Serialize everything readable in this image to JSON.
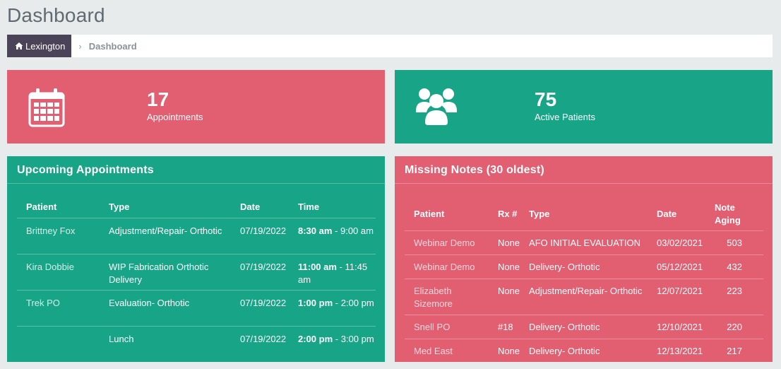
{
  "page": {
    "title": "Dashboard"
  },
  "breadcrumb": {
    "home_label": "Lexington",
    "current": "Dashboard"
  },
  "stats": [
    {
      "value": "17",
      "label": "Appointments",
      "icon": "calendar-icon",
      "color": "#e25e71"
    },
    {
      "value": "75",
      "label": "Active Patients",
      "icon": "users-icon",
      "color": "#17a487"
    }
  ],
  "appointments": {
    "title": "Upcoming Appointments",
    "columns": [
      "Patient",
      "Type",
      "Date",
      "Time"
    ],
    "rows": [
      {
        "patient": "Brittney Fox",
        "type": "Adjustment/Repair- Orthotic",
        "date": "07/19/2022",
        "start": "8:30 am",
        "end": " - 9:00 am"
      },
      {
        "patient": "Kira Dobbie",
        "type": "WIP Fabrication Orthotic Delivery",
        "date": "07/19/2022",
        "start": "11:00 am",
        "end": " - 11:45 am"
      },
      {
        "patient": "Trek PO",
        "type": "Evaluation- Orthotic",
        "date": "07/19/2022",
        "start": "1:00 pm",
        "end": " - 2:00 pm"
      },
      {
        "patient": "",
        "type": "Lunch",
        "date": "07/19/2022",
        "start": "2:00 pm",
        "end": " - 3:00 pm"
      }
    ]
  },
  "missing_notes": {
    "title": "Missing Notes (30 oldest)",
    "columns": [
      "Patient",
      "Rx #",
      "Type",
      "Date",
      "Note Aging"
    ],
    "rows": [
      {
        "patient": "Webinar Demo",
        "rx": "None",
        "type": "AFO INITIAL EVALUATION",
        "date": "03/02/2021",
        "aging": "503"
      },
      {
        "patient": "Webinar Demo",
        "rx": "None",
        "type": "Delivery- Orthotic",
        "date": "05/12/2021",
        "aging": "432"
      },
      {
        "patient": "Elizabeth Sizemore",
        "rx": "None",
        "type": "Adjustment/Repair- Orthotic",
        "date": "12/07/2021",
        "aging": "223"
      },
      {
        "patient": "Snell PO",
        "rx": "#18",
        "type": "Delivery- Orthotic",
        "date": "12/10/2021",
        "aging": "220"
      },
      {
        "patient": "Med East",
        "rx": "None",
        "type": "Delivery- Orthotic",
        "date": "12/13/2021",
        "aging": "217"
      }
    ]
  }
}
